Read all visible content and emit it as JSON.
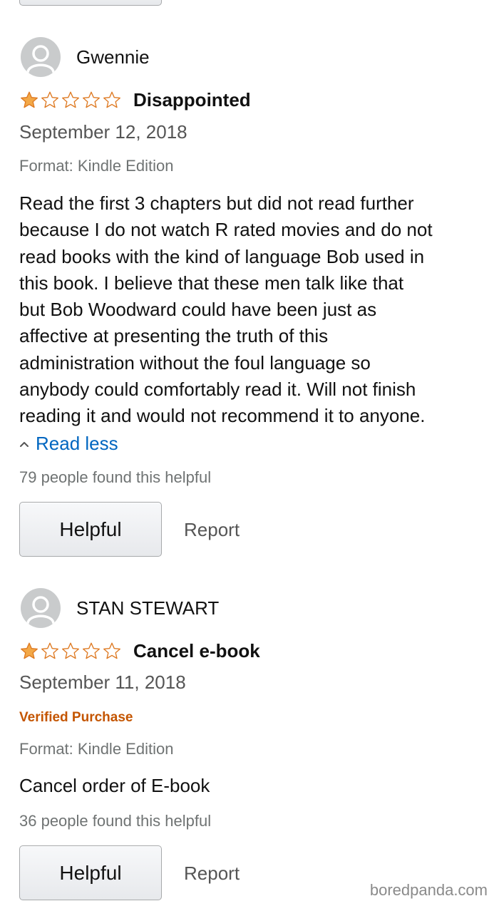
{
  "buttons": {
    "helpful_label": "Helpful",
    "report_label": "Report"
  },
  "star_colors": {
    "filled": "#f3a847",
    "outline": "#de7921"
  },
  "reviews": [
    {
      "reviewer": "Gwennie",
      "rating": 1,
      "rating_max": 5,
      "title": "Disappointed",
      "date": "September 12, 2018",
      "format": "Format: Kindle Edition",
      "lines": [
        "Read the first 3 chapters but did not read further",
        "because I do not watch R rated movies and do not",
        "read books with the kind of language Bob used in",
        "this book. I believe that these men talk like that",
        "but Bob Woodward could have been just as",
        "affective at presenting the truth of this",
        "administration without the foul language so",
        "anybody could comfortably read it. Will not finish",
        "reading it and would not recommend it to anyone."
      ],
      "read_less": "Read less",
      "helpful_count": "79 people found this helpful"
    },
    {
      "reviewer": "STAN STEWART",
      "rating": 1,
      "rating_max": 5,
      "title": "Cancel e-book",
      "date": "September 11, 2018",
      "verified": "Verified Purchase",
      "format": "Format: Kindle Edition",
      "lines": [
        "Cancel order of E-book"
      ],
      "helpful_count": "36 people found this helpful"
    }
  ],
  "watermark": "boredpanda.com"
}
